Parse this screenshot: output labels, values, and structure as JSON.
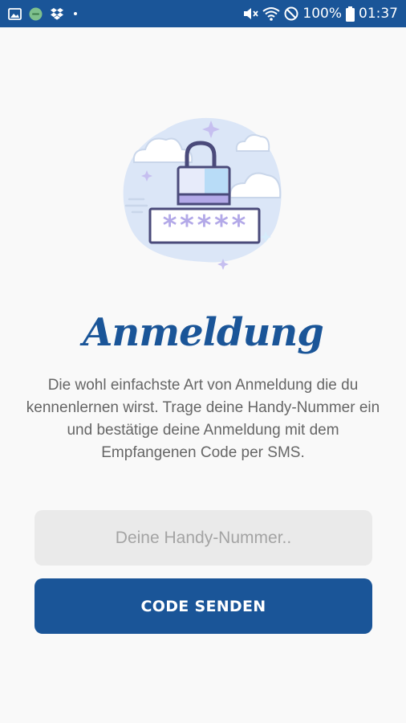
{
  "status_bar": {
    "left_icons": [
      "image-icon",
      "app-circle-icon",
      "dropbox-icon",
      "dot-icon"
    ],
    "right_icons": [
      "mute-icon",
      "wifi-icon",
      "do-not-disturb-icon",
      "battery-icon"
    ],
    "battery": "100%",
    "time": "01:37",
    "background": "#1a5598"
  },
  "hero": {
    "icon": "lock-password-illustration",
    "password_mask": "*****"
  },
  "login": {
    "title": "Anmeldung",
    "description": "Die wohl einfachste Art von Anmeldung die du kennenlernen wirst. Trage deine Handy-Nummer ein und bestätige deine Anmeldung mit dem Empfangenen Code per SMS.",
    "phone_placeholder": "Deine Handy-Nummer..",
    "phone_value": "",
    "submit_label": "CODE SENDEN"
  },
  "colors": {
    "primary": "#1a5598",
    "background": "#f9f9f9",
    "input_background": "#eaeaea",
    "text_muted": "#666666"
  }
}
